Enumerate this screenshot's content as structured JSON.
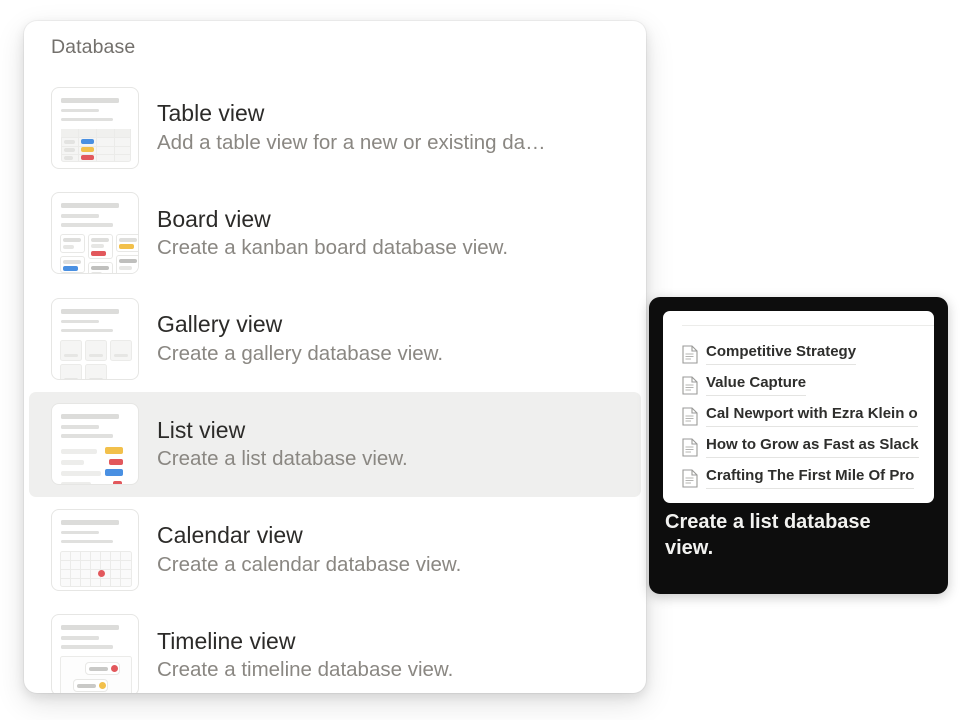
{
  "menu": {
    "section_title": "Database",
    "items": [
      {
        "id": "table-view",
        "title": "Table view",
        "description": "Add a table view for a new or existing da…",
        "icon": "table-view-icon",
        "selected": false
      },
      {
        "id": "board-view",
        "title": "Board view",
        "description": "Create a kanban board database view.",
        "icon": "board-view-icon",
        "selected": false
      },
      {
        "id": "gallery-view",
        "title": "Gallery view",
        "description": "Create a gallery database view.",
        "icon": "gallery-view-icon",
        "selected": false
      },
      {
        "id": "list-view",
        "title": "List view",
        "description": "Create a list database view.",
        "icon": "list-view-icon",
        "selected": true
      },
      {
        "id": "calendar-view",
        "title": "Calendar view",
        "description": "Create a calendar database view.",
        "icon": "calendar-view-icon",
        "selected": false
      },
      {
        "id": "timeline-view",
        "title": "Timeline view",
        "description": "Create a timeline database view.",
        "icon": "timeline-view-icon",
        "selected": false
      }
    ]
  },
  "tooltip": {
    "caption": "Create a list database view.",
    "preview_rows": [
      {
        "icon": "document-icon",
        "label": "Competitive Strategy"
      },
      {
        "icon": "document-icon",
        "label": "Value Capture"
      },
      {
        "icon": "document-icon",
        "label": "Cal Newport with Ezra Klein o"
      },
      {
        "icon": "document-icon",
        "label": "How to Grow as Fast as Slack"
      },
      {
        "icon": "document-icon",
        "label": "Crafting The First Mile Of Pro"
      }
    ]
  },
  "colors": {
    "panel_background": "#ffffff",
    "page_background": "#ffffff",
    "selected_row": "#efefee",
    "title_text": "#2c2b29",
    "description_text": "#8a8782",
    "section_title_text": "#73706c",
    "tooltip_background": "#0d0d0d",
    "tooltip_text": "#f2f2f0",
    "accent_blue": "#4a90e2",
    "accent_yellow": "#f2c04b",
    "accent_red": "#e2585c",
    "thumb_gray": "#e0e0de"
  }
}
